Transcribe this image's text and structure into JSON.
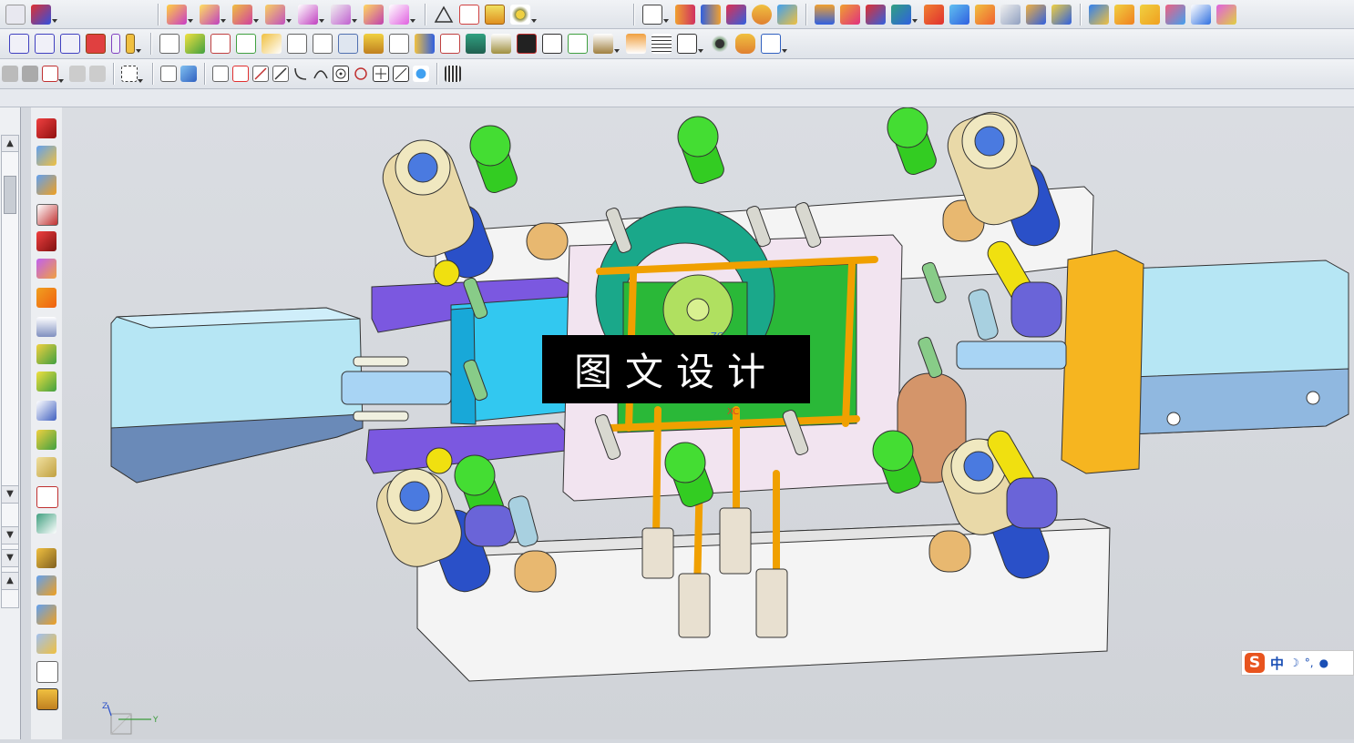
{
  "toolbars": {
    "row1_icons": [
      "part-icon",
      "sketch-icon",
      "boolean-icon",
      "extrude-icon",
      "revolve-icon",
      "hole-icon",
      "shell-icon",
      "draft-icon",
      "chamfer-icon",
      "triangle-icon",
      "table-icon",
      "grid-icon",
      "pattern-icon",
      "plane-icon",
      "box-icon",
      "cylinder-icon",
      "cone-icon",
      "sphere-icon",
      "torus-icon",
      "sweep-icon",
      "loft-icon",
      "blend-icon",
      "offset-icon",
      "thicken-icon",
      "trim-icon",
      "extend-icon",
      "mirror-icon",
      "split-icon",
      "sew-icon",
      "patch-icon",
      "face-icon",
      "body-icon",
      "surface-icon",
      "mold-icon",
      "slider-icon",
      "lifter-icon",
      "insert-icon",
      "ejector-icon"
    ],
    "row2_icons": [
      "align-left-icon",
      "align-center-icon",
      "align-right-icon",
      "distribute-icon",
      "spacer-icon",
      "bar-icon",
      "parts-list-icon",
      "edit-icon",
      "constraint-icon",
      "axis-icon",
      "assembly-icon",
      "layer-icon",
      "explode-icon",
      "tools-icon",
      "stack-icon",
      "layout-icon",
      "measure-icon",
      "weld-icon",
      "building-icon",
      "terrain-icon",
      "film-icon",
      "link-icon",
      "network-icon",
      "anchor-icon",
      "person-icon",
      "sheet-icon",
      "window-icon",
      "eye-icon",
      "database-icon",
      "document-icon"
    ],
    "row3_icons": [
      "select-icon",
      "snap-icon",
      "rotate-icon",
      "pan-icon",
      "box-select-icon",
      "view-icon",
      "shaded-icon",
      "grid-dots-icon",
      "move-icon",
      "line-icon",
      "curve-icon",
      "arc-icon",
      "point-icon",
      "circle-icon",
      "plus-icon",
      "slash-icon",
      "pin-icon",
      "filter-icon"
    ]
  },
  "side_toolbar": {
    "icons": [
      "cube-icon",
      "mold-base-icon",
      "cooling-icon",
      "gate-icon",
      "runner-icon",
      "surface-patch-icon",
      "cone-feature-icon",
      "layer-sheet-icon",
      "electrode-icon",
      "spring-icon",
      "material-icon",
      "edit-body-icon",
      "shell-body-icon",
      "section-icon",
      "plane-cut-icon",
      "slot-icon",
      "drill-icon",
      "trim-body-icon",
      "bom-icon",
      "drawing-icon",
      "ejector-pin-icon"
    ]
  },
  "watermark": {
    "text": "图文设计"
  },
  "ime": {
    "logo": "S",
    "mode": "中",
    "moon": "☽",
    "punct": "°,",
    "mic": "🎤"
  },
  "colors": {
    "plate_white": "#f4f4f4",
    "plate_blue": "#b6e6f4",
    "slider_cyan": "#32c8f0",
    "slider_purple": "#7b58e0",
    "guide_bush": "#e9d9a8",
    "pin_blue": "#2a50c8",
    "screw_green": "#33cc22",
    "ring_teal": "#1aa88a",
    "pipe_orange": "#f0a000",
    "block_orange": "#f6b520",
    "support_tan": "#e8b870"
  },
  "triad": {
    "z": "Z",
    "y": "Y"
  }
}
